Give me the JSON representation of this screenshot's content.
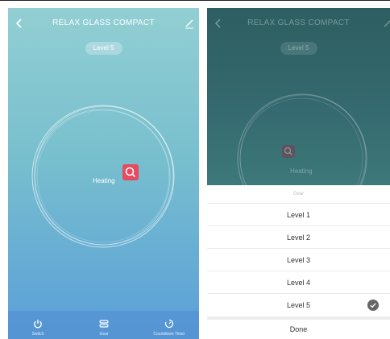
{
  "header": {
    "title": "RELAX GLASS COMPACT"
  },
  "level_badge": "Level 5",
  "status": "Heating",
  "bottom_tabs": [
    {
      "label": "Switch",
      "icon": "power-icon"
    },
    {
      "label": "Gear",
      "icon": "gear-stack-icon"
    },
    {
      "label": "Countdown Timer",
      "icon": "timer-icon"
    }
  ],
  "gear_sheet": {
    "title": "Gear",
    "options": [
      "Level 1",
      "Level 2",
      "Level 3",
      "Level 4",
      "Level 5"
    ],
    "selected": "Level 5",
    "done_label": "Done"
  },
  "colors": {
    "accent": "#e84a5f",
    "panel_top": "#92cfd3",
    "panel_bottom": "#5a9fd8",
    "overlay": "#2d5e61"
  }
}
